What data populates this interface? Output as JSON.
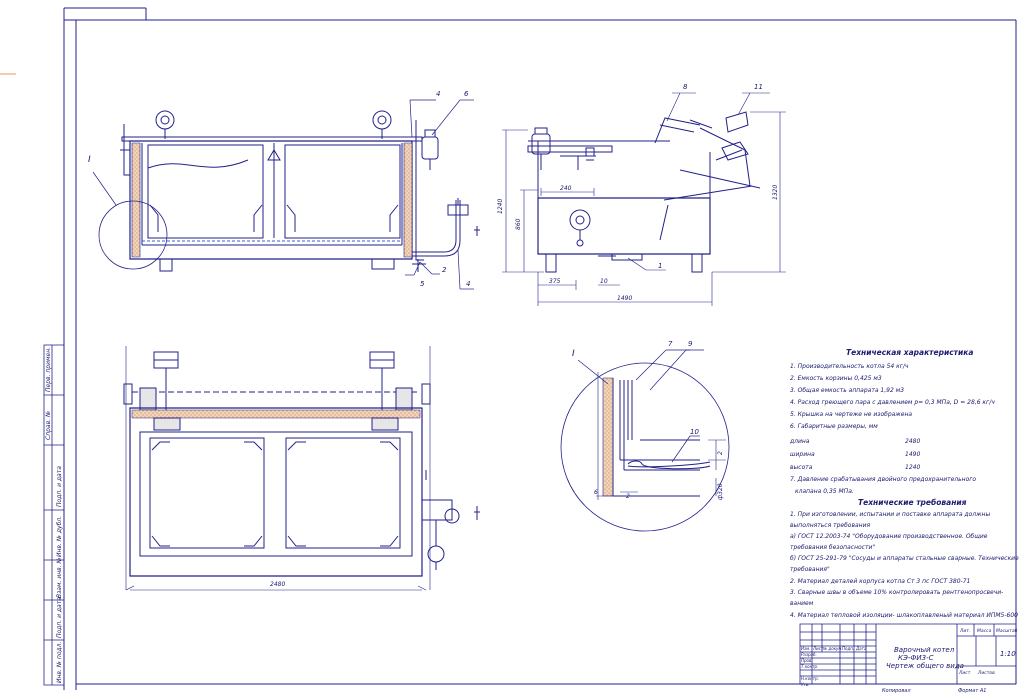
{
  "callouts": {
    "c1": "1",
    "c2": "2",
    "c4a": "4",
    "c4b": "4",
    "c5": "5",
    "c6": "6",
    "c7": "7",
    "c8": "8",
    "c9": "9",
    "c10": "10",
    "c11": "11"
  },
  "section_marks": {
    "left": "I",
    "detail": "I"
  },
  "dims": {
    "height_1240": "1240",
    "height_860": "860",
    "width_240": "240",
    "width_375": "375",
    "width_10": "10",
    "width_1490": "1490",
    "height_1320": "1320",
    "length_2480": "2480",
    "detail_6": "6",
    "detail_2a": "2",
    "detail_2b": "2",
    "detail_dia": "ф320"
  },
  "specs": {
    "heading": "Техническая характеристика",
    "items": [
      "1. Производительность котла    54   кг/ч",
      "2. Емкость корзины 0,425 м3",
      "3. Общая емкость аппарата 1,92 м3",
      "4. Расход греющего пара с давлением р= 0,3 МПа,  D = 28,6 кг/ч",
      "5. Крышка на чертеже не изображена",
      "6. Габаритные размеры, мм"
    ],
    "dims_rows": [
      {
        "label": "длина",
        "value": "2480"
      },
      {
        "label": "ширина",
        "value": "1490"
      },
      {
        "label": "высота",
        "value": "1240"
      }
    ],
    "item7_a": "7. Давление срабатывания двойного предохранительного",
    "item7_b": "клапана 0,35 МПа."
  },
  "requirements": {
    "heading": "Технические требования",
    "lines": [
      "1. При  изготовлении, испытании и поставке аппарата должны",
      "выполняться требования",
      "  а) ГОСТ 12.2003-74  \"Оборудование производственное. Общие",
      "требования безопасности\"",
      "  б) ГОСТ 25-291-79 \"Сосуды и аппараты стальные сварные. Технические",
      "требования\"",
      "2. Материал деталей корпуса котла   Ст 3 пс    ГОСТ 380-71",
      "3. Сварные швы в объеме 10% контролировать рентгенопросвечи-",
      "ванием",
      "4. Материал тепловой изоляции- шлакоплавленый материал ИПМ5-600"
    ]
  },
  "titleblock": {
    "name_line1": "Варочный котел",
    "name_line2": "КЭ-ФИ3-С",
    "name_line3": "Чертеж общего вида",
    "lit_header": "Лит.",
    "mass_header": "Масса",
    "scale_header": "Масштаб",
    "scale": "1:10",
    "sheet_label": "Лист",
    "sheets_label": "Листов",
    "row_labels": [
      "Изм.",
      "Лист",
      "№ докум.",
      "Подп.",
      "Дата"
    ],
    "roles": [
      "Разраб.",
      "Пров.",
      "Т.контр.",
      "",
      "Н.контр.",
      "Утв."
    ],
    "copied": "Копировал",
    "format": "Формат   А1"
  },
  "side_stamps": [
    "Перв. примен.",
    "Справ. №",
    "Подп. и дата",
    "Инв. № дубл.",
    "Взам. инв. №",
    "Подп. и дата",
    "Инв. № подл."
  ]
}
